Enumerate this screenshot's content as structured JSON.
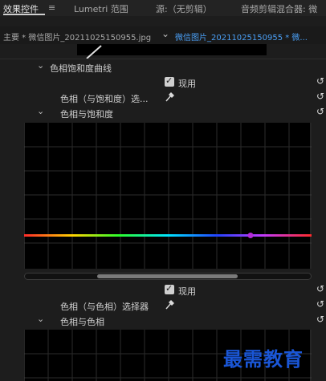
{
  "tabs": [
    {
      "label": "效果控件"
    },
    {
      "label": "≡"
    },
    {
      "label": "Lumetri 范围"
    },
    {
      "label": "源:（无剪辑）"
    },
    {
      "label": "音频剪辑混合器: 微"
    }
  ],
  "clip_header": {
    "master_label": "主要 * 微信图片_20211025150955.jpg",
    "sequence_label": "微信图片_20211025150955 * 微..."
  },
  "sections": {
    "hue_sat_curves": "色相饱和度曲线",
    "enable_label_1": "现用",
    "hue_vs_sat_selector": "色相（与饱和度）选...",
    "hue_vs_sat": "色相与饱和度",
    "enable_label_2": "现用",
    "hue_vs_hue_selector": "色相（与色相）选择器",
    "hue_vs_hue": "色相与色相"
  },
  "watermark": "最需教育",
  "colors": {
    "accent_blue": "#4a9ff5",
    "control_point": "#b42bd8",
    "watermark": "#1a56d6"
  }
}
